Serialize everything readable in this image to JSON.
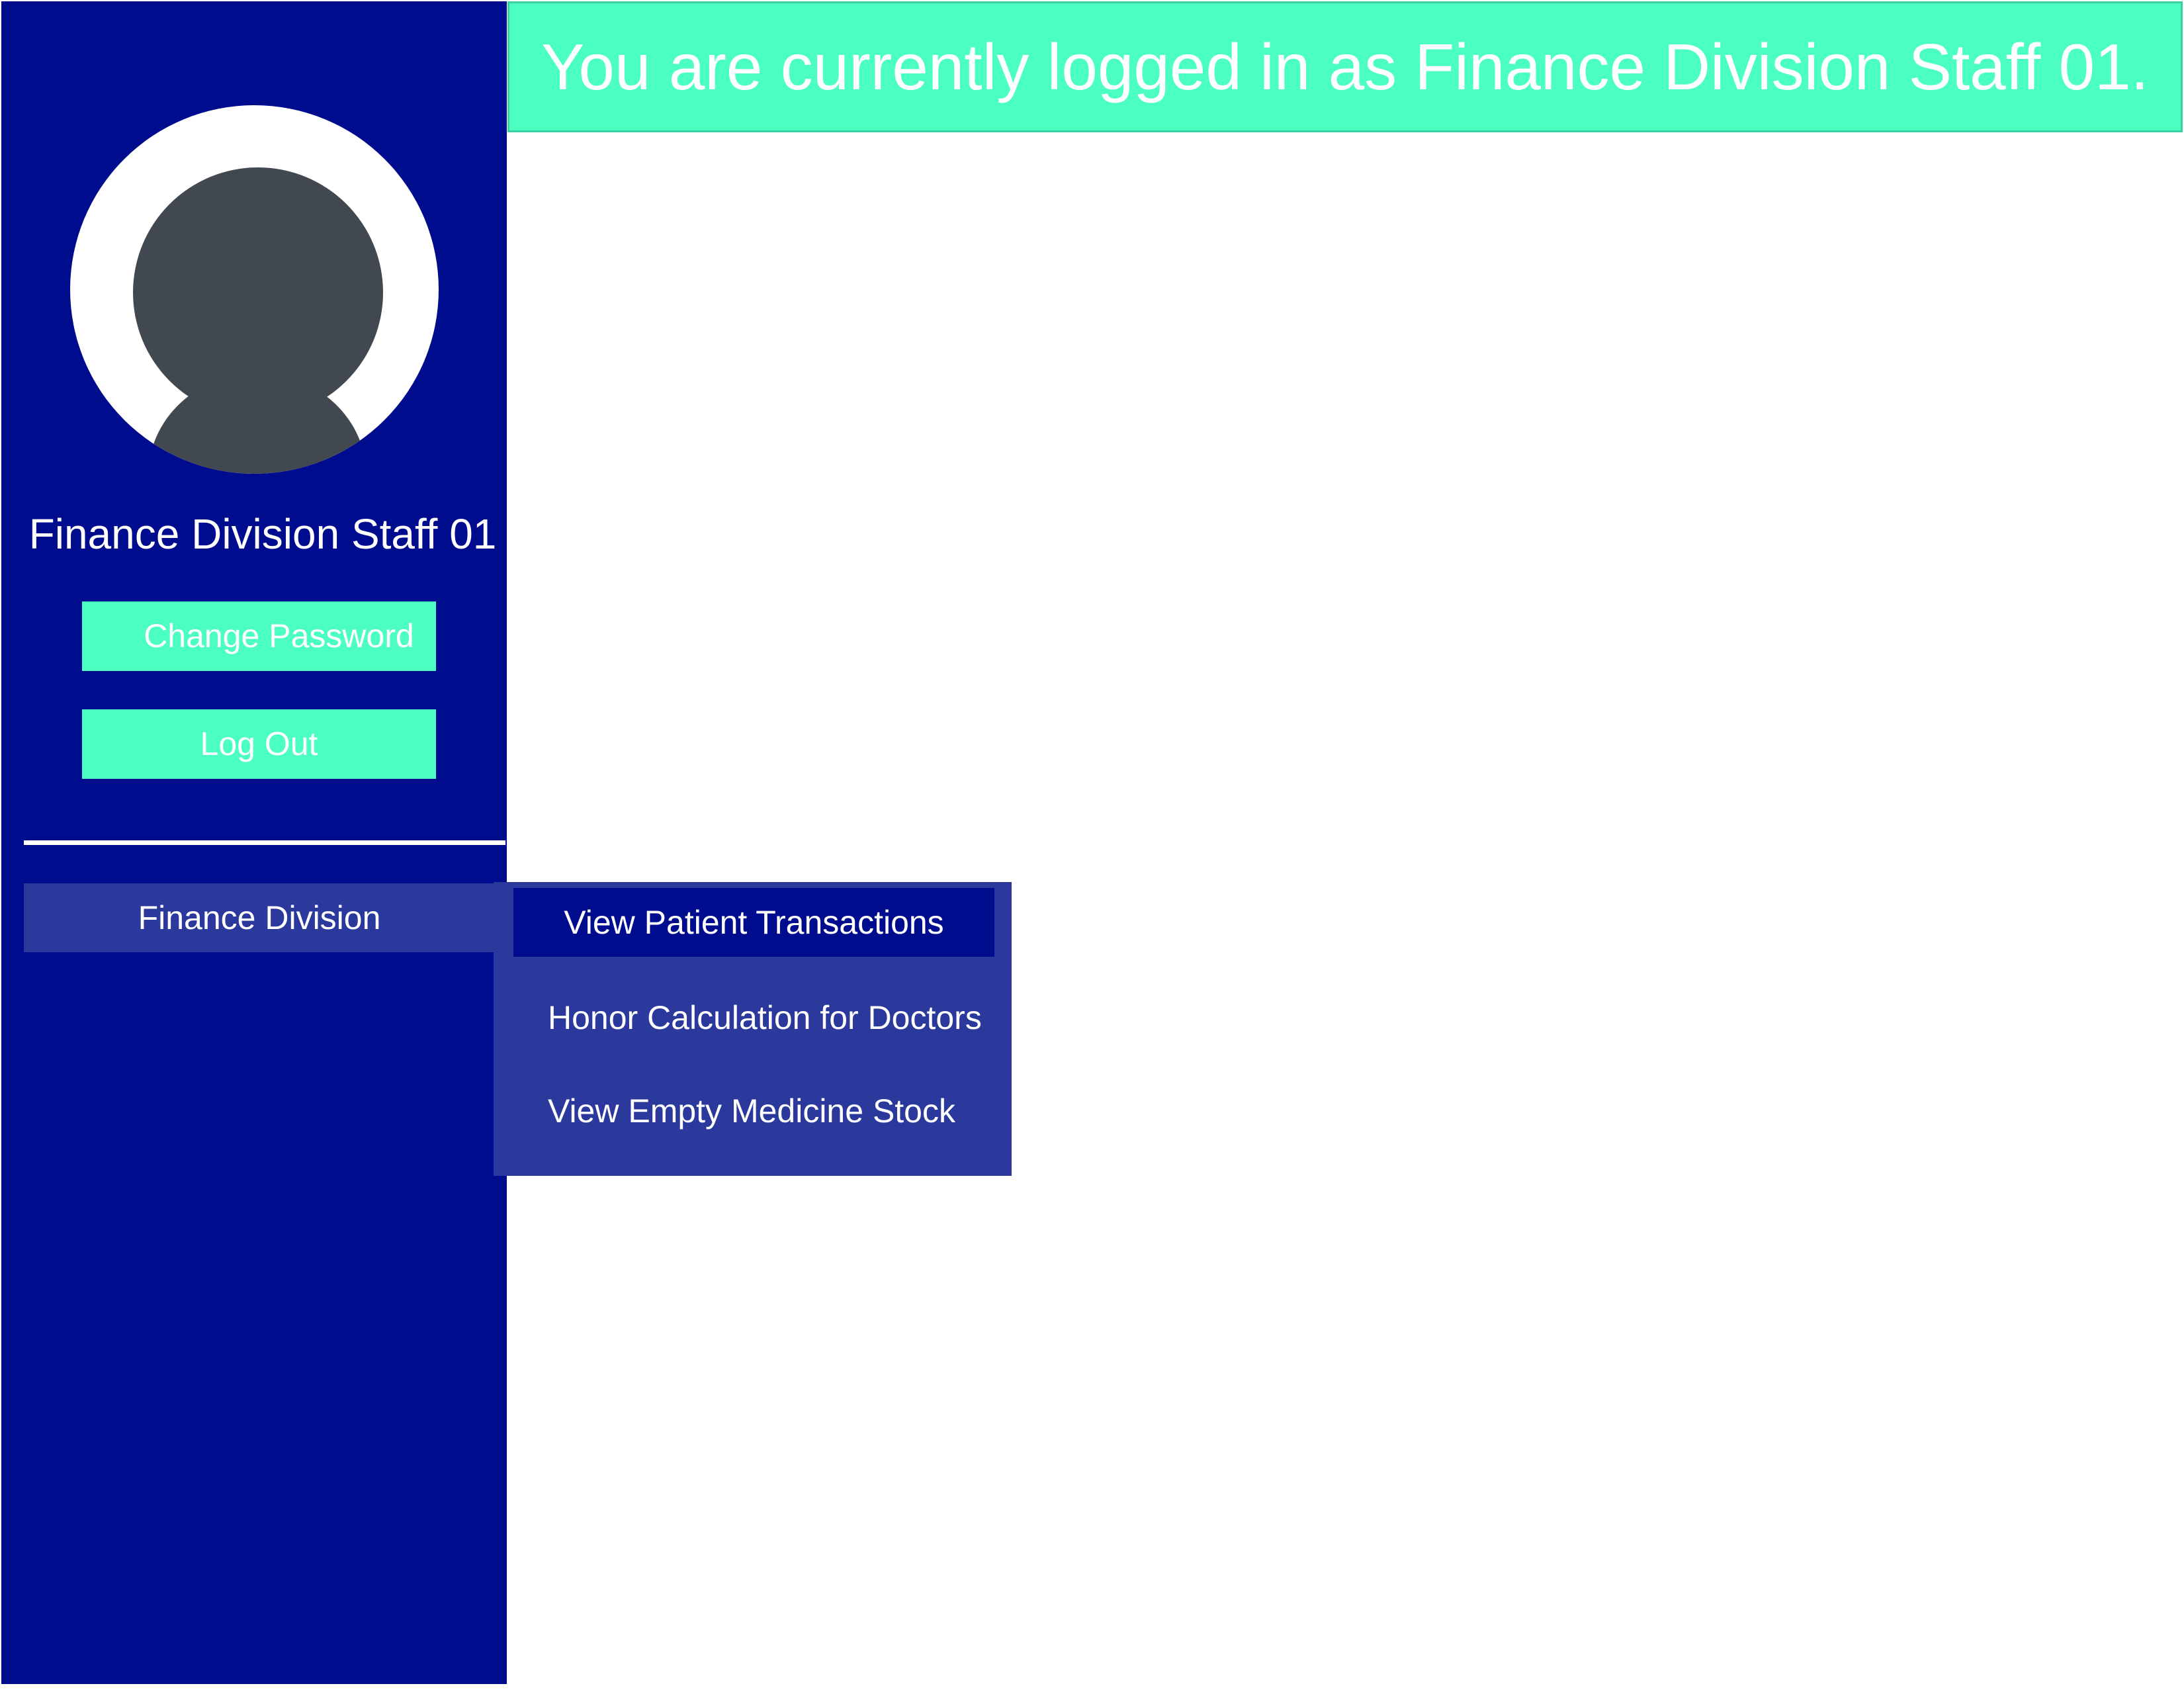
{
  "header": {
    "banner_text": "You are currently logged in as Finance Division Staff 01."
  },
  "sidebar": {
    "username": "Finance Division Staff 01",
    "change_password_label": "Change Password",
    "logout_label": "Log Out",
    "nav_item_label": "Finance Division"
  },
  "submenu": {
    "items": [
      {
        "label": "View Patient Transactions",
        "selected": true
      },
      {
        "label": "Honor Calculation for Doctors"
      },
      {
        "label": "View Empty Medicine Stock"
      }
    ]
  },
  "colors": {
    "sidebar_bg": "#000c8e",
    "accent": "#4affc0",
    "nav_item_bg": "#2c399c",
    "avatar_fill": "#41484f"
  }
}
